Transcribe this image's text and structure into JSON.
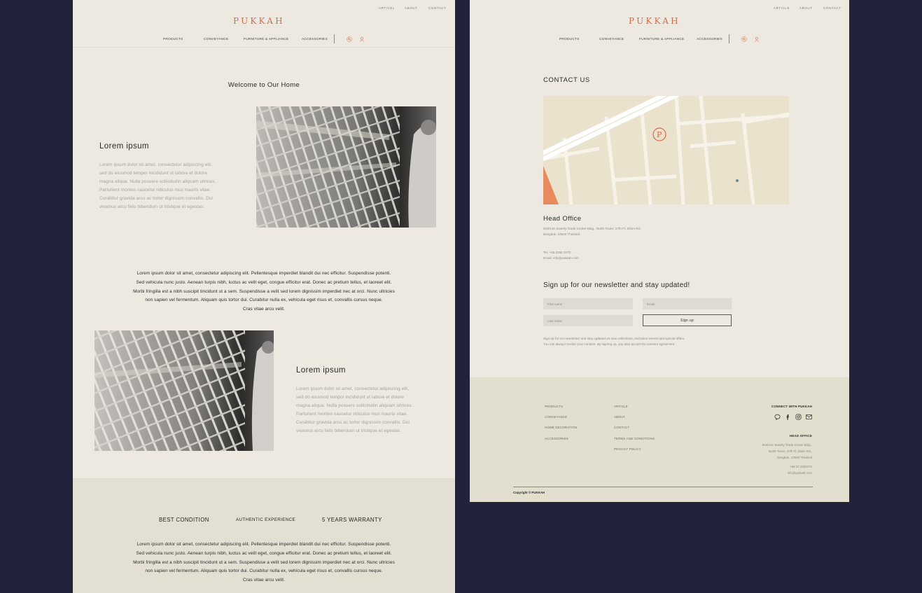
{
  "brand": {
    "logo": "PUKKAH",
    "accent": "#d86a4a"
  },
  "top_links": [
    "ARTICEL",
    "ABOUT",
    "CONTACT"
  ],
  "top_links_p2": [
    "ARTICLE",
    "ABOUT",
    "CONTACT"
  ],
  "nav": {
    "items": [
      "PRODUCTS",
      "CONVEYANCE",
      "FURNITURE & APPLIANCE",
      "ACCESSORIES"
    ],
    "icons": [
      "search-icon",
      "user-icon"
    ]
  },
  "home": {
    "welcome": "Welcome to Our Home",
    "section1": {
      "heading": "Lorem ipsum",
      "body": [
        "Lorem ipsum dolor sit amet, consectetur adipiscing elit,",
        "sed do eiusmod tempor incididunt ut labore et dolore",
        "magna aliqua. Nulla posuere sollicitudin aliquam ultrices.",
        "Parturient montes nascetur ridiculus mus mauris vitae.",
        "Curabitur gravida arcu ac tortor dignissim convallis. Dui",
        "vivamus arcu felis bibendum ut tristique et egestas."
      ]
    },
    "center_paragraph": [
      "Lorem ipsum dolor sit amet, consectetur adipiscing elit. Pellentesque imperdiet blandit dui nec efficitur. Suspendisse potenti.",
      "Sed vehicula nunc justo. Aenean turpis nibh, luctus ac velit eget, congue efficitur erat. Donec ac pretium tellus, et laoreet elit.",
      "Morbi fringilla est a nibh suscipit tincidunt ut a sem. Suspendisse a velit sed lorem dignissim imperdiet nec at orci. Nunc ultricies",
      "non sapien vel fermentum. Aliquam quis tortor dui. Curabitur nulla ex, vehicula eget risus et, convallis cursus neque.",
      "Cras vitae arcu velit."
    ],
    "section2": {
      "heading": "Lorem ipsum",
      "body": [
        "Lorem ipsum dolor sit amet, consectetur adipiscing elit,",
        "sed do eiusmod tempor incididunt ut labore et dolore",
        "magna aliqua. Nulla posuere sollicitudin aliquam ultrices.",
        "Parturient montes nascetur ridiculus mus mauris vitae.",
        "Curabitur gravida arcu ac tortor dignissim convallis. Dui",
        "vivamus arcu felis bibendum ut tristique et egestas."
      ]
    },
    "features": [
      "BEST CONDITION",
      "AUTHENTIC EXPERIENCE",
      "5 YEARS WARRANTY"
    ],
    "feature_paragraph": [
      "Lorem ipsum dolor sit amet, consectetur adipiscing elit. Pellentesque imperdiet blandit dui nec efficitur. Suspendisse potenti.",
      "Sed vehicula nunc justo. Aenean turpis nibh, luctus ac velit eget, congue efficitur erat. Donec ac pretium tellus, et laoreet elit.",
      "Morbi fringilla est a nibh suscipit tincidunt ut a sem. Suspendisse a velit sed lorem dignissim imperdiet nec at orci. Nunc ultricies",
      "non sapien vel fermentum. Aliquam quis tortor dui. Curabitur nulla ex, vehicula eget risus et, convallis cursus neque.",
      "Cras vitae arcu velit."
    ]
  },
  "contact": {
    "title": "CONTACT US",
    "head_office": "Head Office",
    "address": [
      "919/443 Jewelry Trade Center Bldg., North Tower, 37th Fl.,Silom Rd.,",
      "Bangkok, 10500 Thailand"
    ],
    "tel": "Tel. +66 2258 3470",
    "email": "Email: info@pukkah.com",
    "newsletter_title": "Sign up for our newsletter and stay updated!",
    "fields": {
      "first_name": "First name",
      "email": "Email",
      "last_name": "Last name"
    },
    "signup_button": "Sign up",
    "consent": [
      "Sign up for our newsletter and stay updated on new collections, exclusive events and special offers.",
      "You can always revoke your consent. By signing up, you also accept the consent agreement."
    ]
  },
  "footer": {
    "col1": [
      "PRODUCTS",
      "CONVEYANCE",
      "HOME DECORATION",
      "ACCESSORIES"
    ],
    "col2": [
      "ARTICLE",
      "ABOUT",
      "CONTACT",
      "TERMS AND CONDITIONS",
      "PRIVACY POLICY"
    ],
    "connect_title": "CONNECT  WITH PUKKAH",
    "social_icons": [
      "line-icon",
      "facebook-icon",
      "instagram-icon",
      "mail-icon"
    ],
    "head_office_title": "HEAD OFFICE",
    "head_office_lines": [
      "919/443 Jewelry Trade Center Bldg.,",
      "North Tower, 37th Fl.,Silom Rd.,",
      "Bangkok, 10500 Thailand"
    ],
    "phone": "+66 02 2563470",
    "email": "info@pukkah.com",
    "copyright": "Copyright © PUKKAH"
  }
}
